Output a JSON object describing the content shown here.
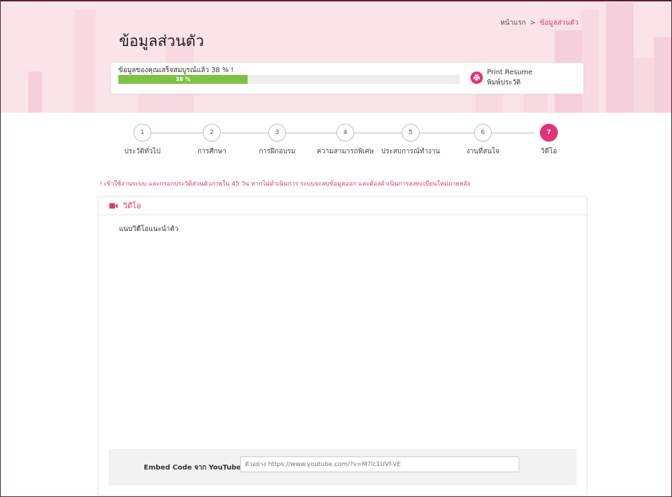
{
  "breadcrumb": {
    "home": "หน้าแรก",
    "separator": ">",
    "current": "ข้อมูลส่วนตัว"
  },
  "page_title": "ข้อมูลส่วนตัว",
  "profile_progress": {
    "text": "ข้อมูลของคุณเสร็จสมบูรณ์แล้ว 38 % !",
    "percent": 38,
    "bar_label": "38 %"
  },
  "print_resume": {
    "label_en": "Print Resume",
    "label_th": "พิมพ์ประวัติ",
    "icon": "printer-icon"
  },
  "steps": [
    {
      "num": "1",
      "label": "ประวัติทั่วไป",
      "active": false
    },
    {
      "num": "2",
      "label": "การศึกษา",
      "active": false
    },
    {
      "num": "3",
      "label": "การฝึกอบรม",
      "active": false
    },
    {
      "num": "4",
      "label": "ความสามารถพิเศษ",
      "active": false
    },
    {
      "num": "5",
      "label": "ประสบการณ์ทำงาน",
      "active": false
    },
    {
      "num": "6",
      "label": "งานที่สนใจ",
      "active": false
    },
    {
      "num": "7",
      "label": "วิดีโอ",
      "active": true
    }
  ],
  "notice": "! เข้าใช้งานระบบ และกรอกประวัติส่วนตัวภายใน 45 วัน หากไม่ดำเนินการ ระบบจะลบข้อมูลออก และต้องดำเนินการลงทะเบียนใหม่ภายหลัง",
  "video_panel": {
    "title": "วิดีโอ",
    "icon": "video-camera-icon",
    "subtitle": "แนบวิดีโอแนะนำตัว",
    "embed_label": "Embed Code จาก YouTube",
    "embed_value": "",
    "embed_placeholder": "ตัวอย่าง https://www.youtube.com/?v=M7lc1UVf-VE"
  },
  "colors": {
    "accent": "#e0337a",
    "progress": "#7dc244",
    "banner": "#fbe3ea"
  }
}
